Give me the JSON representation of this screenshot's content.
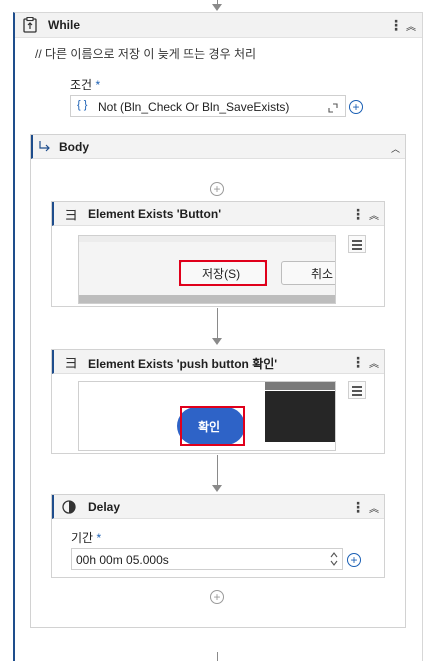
{
  "while": {
    "title": "While",
    "comment": "// 다른 이름으로 저장 이 늦게 뜨는 경우 처리",
    "condition_label": "조건",
    "required_mark": "*",
    "condition_value": "Not (Bln_Check Or Bln_SaveExists)",
    "expr_icon": "{ }"
  },
  "body": {
    "title": "Body"
  },
  "activities": [
    {
      "title": "Element Exists 'Button'",
      "preview_save_label": "저장(S)",
      "preview_cancel_label": "취소"
    },
    {
      "title": "Element Exists 'push button  확인'",
      "preview_ok_label": "확인"
    },
    {
      "title": "Delay",
      "duration_label": "기간",
      "required_mark": "*",
      "duration_value": "00h 00m 05.000s"
    }
  ],
  "icons": {
    "kebab": "⋮",
    "collapse": "︽",
    "plus": "+"
  },
  "colors": {
    "accent_blue": "#1a5fb4",
    "border_blue": "#1e4d8c",
    "highlight_red": "#e0001b"
  }
}
